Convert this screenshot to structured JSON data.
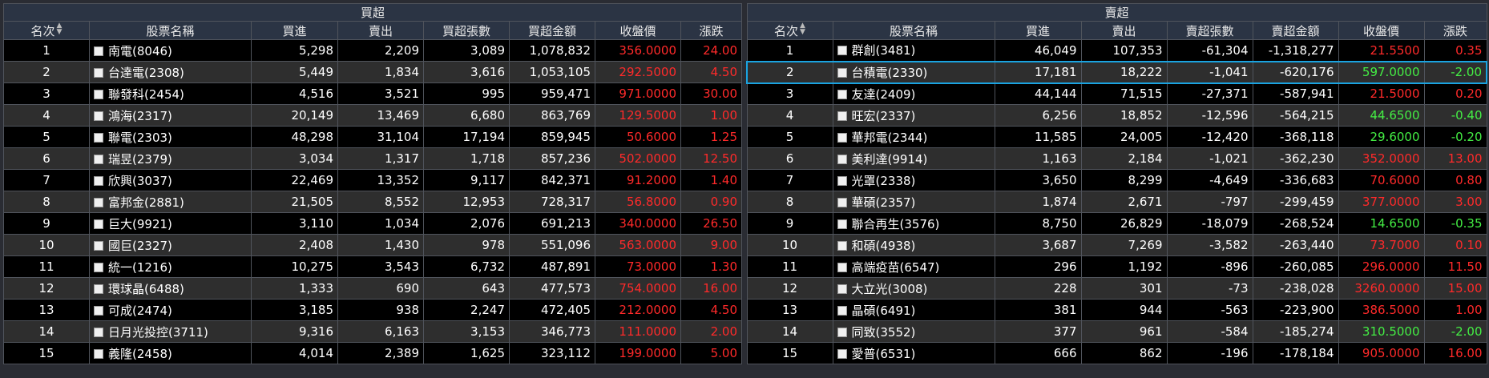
{
  "colors": {
    "up": "#ff2a2a",
    "down": "#44ee44",
    "select": "#1aa3e0"
  },
  "buy": {
    "title": "買超",
    "headers": [
      "名次",
      "股票名稱",
      "買進",
      "賣出",
      "買超張數",
      "買超金額",
      "收盤價",
      "漲跌"
    ],
    "rows": [
      [
        "1",
        "南電(8046)",
        "5,298",
        "2,209",
        "3,089",
        "1,078,832",
        "356.0000",
        "24.00"
      ],
      [
        "2",
        "台達電(2308)",
        "5,449",
        "1,834",
        "3,616",
        "1,053,105",
        "292.5000",
        "4.50"
      ],
      [
        "3",
        "聯發科(2454)",
        "4,516",
        "3,521",
        "995",
        "959,471",
        "971.0000",
        "30.00"
      ],
      [
        "4",
        "鴻海(2317)",
        "20,149",
        "13,469",
        "6,680",
        "863,769",
        "129.5000",
        "1.00"
      ],
      [
        "5",
        "聯電(2303)",
        "48,298",
        "31,104",
        "17,194",
        "859,945",
        "50.6000",
        "1.25"
      ],
      [
        "6",
        "瑞昱(2379)",
        "3,034",
        "1,317",
        "1,718",
        "857,236",
        "502.0000",
        "12.50"
      ],
      [
        "7",
        "欣興(3037)",
        "22,469",
        "13,352",
        "9,117",
        "842,371",
        "91.2000",
        "1.40"
      ],
      [
        "8",
        "富邦金(2881)",
        "21,505",
        "8,552",
        "12,953",
        "728,317",
        "56.8000",
        "0.90"
      ],
      [
        "9",
        "巨大(9921)",
        "3,110",
        "1,034",
        "2,076",
        "691,213",
        "340.0000",
        "26.50"
      ],
      [
        "10",
        "國巨(2327)",
        "2,408",
        "1,430",
        "978",
        "551,096",
        "563.0000",
        "9.00"
      ],
      [
        "11",
        "統一(1216)",
        "10,275",
        "3,543",
        "6,732",
        "487,891",
        "73.0000",
        "1.30"
      ],
      [
        "12",
        "環球晶(6488)",
        "1,333",
        "690",
        "643",
        "477,573",
        "754.0000",
        "16.00"
      ],
      [
        "13",
        "可成(2474)",
        "3,185",
        "938",
        "2,247",
        "472,405",
        "212.0000",
        "4.50"
      ],
      [
        "14",
        "日月光投控(3711)",
        "9,316",
        "6,163",
        "3,153",
        "346,773",
        "111.0000",
        "2.00"
      ],
      [
        "15",
        "義隆(2458)",
        "4,014",
        "2,389",
        "1,625",
        "323,112",
        "199.0000",
        "5.00"
      ]
    ],
    "price_dir": [
      "up",
      "up",
      "up",
      "up",
      "up",
      "up",
      "up",
      "up",
      "up",
      "up",
      "up",
      "up",
      "up",
      "up",
      "up"
    ]
  },
  "sell": {
    "title": "賣超",
    "headers": [
      "名次",
      "股票名稱",
      "買進",
      "賣出",
      "賣超張數",
      "賣超金額",
      "收盤價",
      "漲跌"
    ],
    "rows": [
      [
        "1",
        "群創(3481)",
        "46,049",
        "107,353",
        "-61,304",
        "-1,318,277",
        "21.5500",
        "0.35"
      ],
      [
        "2",
        "台積電(2330)",
        "17,181",
        "18,222",
        "-1,041",
        "-620,176",
        "597.0000",
        "-2.00"
      ],
      [
        "3",
        "友達(2409)",
        "44,144",
        "71,515",
        "-27,371",
        "-587,941",
        "21.5000",
        "0.20"
      ],
      [
        "4",
        "旺宏(2337)",
        "6,256",
        "18,852",
        "-12,596",
        "-564,215",
        "44.6500",
        "-0.40"
      ],
      [
        "5",
        "華邦電(2344)",
        "11,585",
        "24,005",
        "-12,420",
        "-368,118",
        "29.6000",
        "-0.20"
      ],
      [
        "6",
        "美利達(9914)",
        "1,163",
        "2,184",
        "-1,021",
        "-362,230",
        "352.0000",
        "13.00"
      ],
      [
        "7",
        "光罩(2338)",
        "3,650",
        "8,299",
        "-4,649",
        "-336,683",
        "70.6000",
        "0.80"
      ],
      [
        "8",
        "華碩(2357)",
        "1,874",
        "2,671",
        "-797",
        "-299,459",
        "377.0000",
        "3.00"
      ],
      [
        "9",
        "聯合再生(3576)",
        "8,750",
        "26,829",
        "-18,079",
        "-268,524",
        "14.6500",
        "-0.35"
      ],
      [
        "10",
        "和碩(4938)",
        "3,687",
        "7,269",
        "-3,582",
        "-263,440",
        "73.7000",
        "0.10"
      ],
      [
        "11",
        "高端疫苗(6547)",
        "296",
        "1,192",
        "-896",
        "-260,085",
        "296.0000",
        "11.50"
      ],
      [
        "12",
        "大立光(3008)",
        "228",
        "301",
        "-73",
        "-238,028",
        "3260.0000",
        "15.00"
      ],
      [
        "13",
        "晶碩(6491)",
        "381",
        "944",
        "-563",
        "-223,900",
        "386.5000",
        "1.00"
      ],
      [
        "14",
        "同致(3552)",
        "377",
        "961",
        "-584",
        "-185,274",
        "310.5000",
        "-2.00"
      ],
      [
        "15",
        "愛普(6531)",
        "666",
        "862",
        "-196",
        "-178,184",
        "905.0000",
        "16.00"
      ]
    ],
    "price_dir": [
      "up",
      "down",
      "up",
      "down",
      "down",
      "up",
      "up",
      "up",
      "down",
      "up",
      "up",
      "up",
      "up",
      "down",
      "up"
    ],
    "selected_row": 1
  }
}
